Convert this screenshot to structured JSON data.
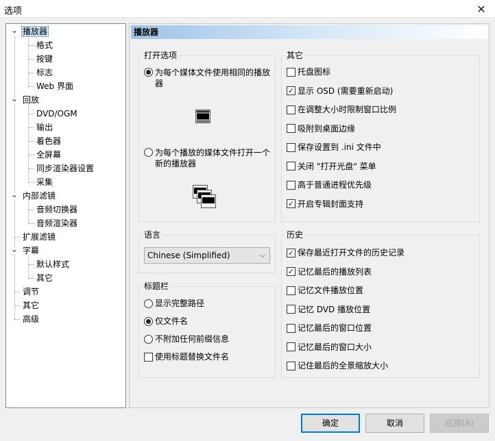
{
  "window": {
    "title": "选项",
    "close_glyph": "✕"
  },
  "tree": {
    "items": [
      {
        "label": "播放器",
        "level": 0,
        "expanded": true,
        "selected": true
      },
      {
        "label": "格式",
        "level": 1
      },
      {
        "label": "按键",
        "level": 1
      },
      {
        "label": "标志",
        "level": 1
      },
      {
        "label": "Web 界面",
        "level": 1
      },
      {
        "label": "回放",
        "level": 0,
        "expanded": true
      },
      {
        "label": "DVD/OGM",
        "level": 1
      },
      {
        "label": "输出",
        "level": 1
      },
      {
        "label": "着色器",
        "level": 1
      },
      {
        "label": "全屏幕",
        "level": 1
      },
      {
        "label": "同步渲染器设置",
        "level": 1
      },
      {
        "label": "采集",
        "level": 1
      },
      {
        "label": "内部滤镜",
        "level": 0,
        "expanded": true
      },
      {
        "label": "音频切换器",
        "level": 1
      },
      {
        "label": "音频渲染器",
        "level": 1
      },
      {
        "label": "扩展滤镜",
        "level": 0
      },
      {
        "label": "字幕",
        "level": 0,
        "expanded": true
      },
      {
        "label": "默认样式",
        "level": 1
      },
      {
        "label": "其它",
        "level": 1
      },
      {
        "label": "调节",
        "level": 0
      },
      {
        "label": "其它",
        "level": 0
      },
      {
        "label": "高级",
        "level": 0
      }
    ]
  },
  "page": {
    "title": "播放器"
  },
  "open_options": {
    "title": "打开选项",
    "opt1": "为每个媒体文件使用相同的播放器",
    "opt1_checked": true,
    "opt2": "为每个播放的媒体文件打开一个新的播放器",
    "opt2_checked": false
  },
  "other": {
    "title": "其它",
    "items": [
      {
        "label": "托盘图标",
        "checked": false
      },
      {
        "label": "显示 OSD (需要重新启动)",
        "checked": true
      },
      {
        "label": "在调整大小时限制窗口比例",
        "checked": false
      },
      {
        "label": "吸附到桌面边缘",
        "checked": false
      },
      {
        "label": "保存设置到 .ini 文件中",
        "checked": false
      },
      {
        "label": "关闭 \"打开光盘\" 菜单",
        "checked": false
      },
      {
        "label": "高于普通进程优先级",
        "checked": false
      },
      {
        "label": "开启专辑封面支持",
        "checked": true
      }
    ]
  },
  "language": {
    "title": "语言",
    "selected": "Chinese (Simplified)",
    "arrow": "⌵"
  },
  "titlebar_group": {
    "title": "标题栏",
    "radios": [
      {
        "label": "显示完整路径",
        "checked": false
      },
      {
        "label": "仅文件名",
        "checked": true
      },
      {
        "label": "不附加任何前缀信息",
        "checked": false
      }
    ],
    "checkbox": {
      "label": "使用标题替换文件名",
      "checked": false
    }
  },
  "history": {
    "title": "历史",
    "items": [
      {
        "label": "保存最近打开文件的历史记录",
        "checked": true
      },
      {
        "label": "记忆最后的播放列表",
        "checked": true
      },
      {
        "label": "记忆文件播放位置",
        "checked": false
      },
      {
        "label": "记忆 DVD 播放位置",
        "checked": false
      },
      {
        "label": "记忆最后的窗口位置",
        "checked": false
      },
      {
        "label": "记忆最后的窗口大小",
        "checked": false
      },
      {
        "label": "记住最后的全景缩放大小",
        "checked": false
      }
    ]
  },
  "buttons": {
    "ok": "确定",
    "cancel": "取消",
    "apply": "应用(A)"
  },
  "colors": {
    "header_gradient_start": "#9ec3e8",
    "selection": "#cce8ff",
    "default_button_border": "#0078d7"
  }
}
